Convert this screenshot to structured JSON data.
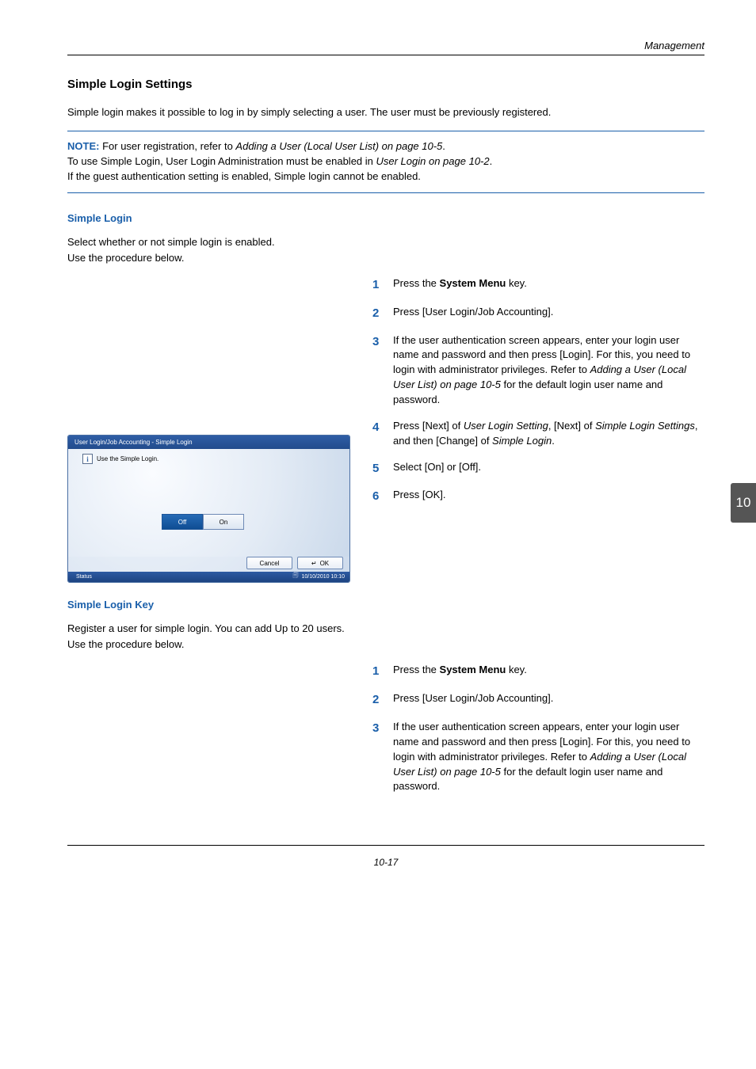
{
  "header": {
    "section": "Management"
  },
  "title": "Simple Login Settings",
  "intro": "Simple login makes it possible to log in by simply selecting a user. The user must be previously registered.",
  "note": {
    "label": "NOTE:",
    "line1_a": "For user registration, refer to ",
    "line1_i": "Adding a User (Local User List) on page 10-5",
    "line1_b": ".",
    "line2_a": "To use Simple Login, User Login Administration must be enabled in ",
    "line2_i": "User Login on page 10-2",
    "line2_b": ".",
    "line3": "If the guest authentication setting is enabled, Simple login cannot be enabled."
  },
  "sub1": {
    "heading": "Simple Login",
    "para1": "Select whether or not simple login is enabled.",
    "para2": "Use the procedure below."
  },
  "steps1": {
    "s1_a": "Press the ",
    "s1_b": "System Menu",
    "s1_c": " key.",
    "s2": "Press [User Login/Job Accounting].",
    "s3_a": "If the user authentication screen appears, enter your login user name and password and then press [Login]. For this, you need to login with administrator privileges. Refer to ",
    "s3_i": "Adding a User (Local User List) on page 10-5",
    "s3_b": " for the default login user name and password.",
    "s4_a": "Press [Next] of ",
    "s4_i1": "User Login Setting",
    "s4_b": ", [Next] of ",
    "s4_i2": "Simple Login Settings",
    "s4_c": ", and then [Change] of ",
    "s4_i3": "Simple Login",
    "s4_d": ".",
    "s5": "Select [On] or [Off].",
    "s6": "Press [OK]."
  },
  "dialog": {
    "title": "User Login/Job Accounting - Simple Login",
    "hint": "Use the Simple Login.",
    "off": "Off",
    "on": "On",
    "cancel": "Cancel",
    "ok": "OK",
    "status": "Status",
    "timestamp": "10/10/2010  10:10"
  },
  "sub2": {
    "heading": "Simple Login Key",
    "para1": "Register a user for simple login. You can add Up to 20 users.",
    "para2": "Use the procedure below."
  },
  "steps2": {
    "s1_a": "Press the ",
    "s1_b": "System Menu",
    "s1_c": " key.",
    "s2": "Press [User Login/Job Accounting].",
    "s3_a": "If the user authentication screen appears, enter your login user name and password and then press [Login]. For this, you need to login with administrator privileges. Refer to ",
    "s3_i": "Adding a User (Local User List) on page 10-5",
    "s3_b": " for the default login user name and password."
  },
  "tab": "10",
  "pagenum": "10-17"
}
